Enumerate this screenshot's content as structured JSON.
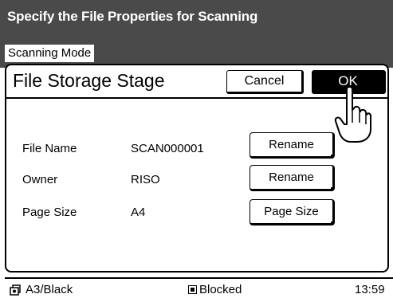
{
  "header": {
    "title": "Specify the File Properties for Scanning",
    "mode_tab": "Scanning Mode"
  },
  "panel": {
    "title": "File Storage Stage",
    "cancel_label": "Cancel",
    "ok_label": "OK"
  },
  "rows": [
    {
      "label": "File Name",
      "value": "SCAN000001",
      "button": "Rename"
    },
    {
      "label": "Owner",
      "value": "RISO",
      "button": "Rename"
    },
    {
      "label": "Page Size",
      "value": "A4",
      "button": "Page Size"
    }
  ],
  "status": {
    "paper": "A3/Black",
    "state": "Blocked",
    "time": "13:59"
  },
  "icons": {
    "paper": "paper-tray-icon",
    "state": "blocked-icon",
    "pointer": "hand-pointer-icon"
  }
}
